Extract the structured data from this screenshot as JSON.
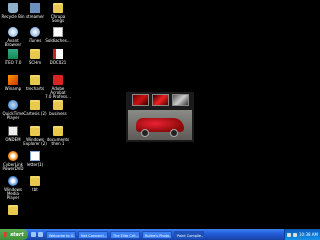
{
  "desktop": {
    "icons": [
      {
        "label": "Recycle Bin"
      },
      {
        "label": "streamer"
      },
      {
        "label": "Chrupa Songs"
      },
      {
        "label": "Avant\nBrowser"
      },
      {
        "label": "iTunes"
      },
      {
        "label": "Soldiaches..."
      },
      {
        "label": "iTEO 7.0"
      },
      {
        "label": "SCHm"
      },
      {
        "label": "DOC021"
      },
      {
        "label": "Winamp"
      },
      {
        "label": "trecharts"
      },
      {
        "label": "Adobe Acrobat\n7.0 Profess..."
      },
      {
        "label": "QuickTime\nPlayer"
      },
      {
        "label": "Cartesis (2)"
      },
      {
        "label": "business"
      },
      {
        "label": "ONDEM"
      },
      {
        "label": "Windows\nExplorer (2)"
      },
      {
        "label": "documents\nthen 1"
      },
      {
        "label": "CyberLink\nPowerDVD"
      },
      {
        "label": "letter(1)"
      },
      {
        "label": "Windows Media\nPlayer"
      },
      {
        "label": "tbt"
      },
      {
        "label": ""
      }
    ]
  },
  "taskbar": {
    "start_label": "start",
    "buttons": [
      {
        "label": "Welcome to G..."
      },
      {
        "label": "Net Connecti..."
      },
      {
        "label": "The Elite Crit..."
      },
      {
        "label": "Ruthe's Photo..."
      },
      {
        "label": "Paint Compile..."
      }
    ],
    "clock": "10:38 AM"
  }
}
